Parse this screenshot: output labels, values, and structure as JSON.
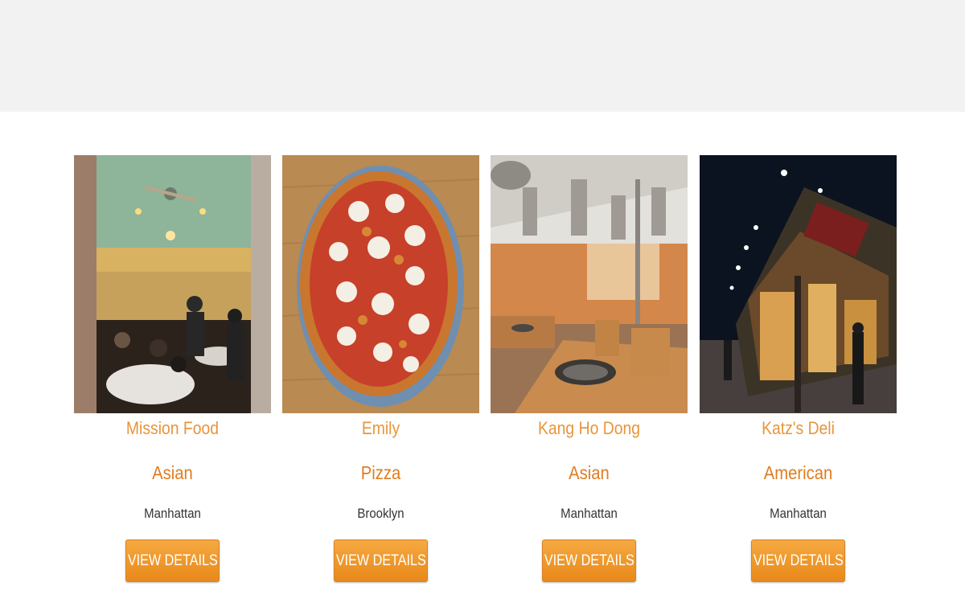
{
  "restaurants": [
    {
      "name": "Mission Food",
      "cuisine": "Asian",
      "borough": "Manhattan",
      "button_label": "VIEW DETAILS"
    },
    {
      "name": "Emily",
      "cuisine": "Pizza",
      "borough": "Brooklyn",
      "button_label": "VIEW DETAILS"
    },
    {
      "name": "Kang Ho Dong",
      "cuisine": "Asian",
      "borough": "Manhattan",
      "button_label": "VIEW DETAILS"
    },
    {
      "name": "Katz's Deli",
      "cuisine": "American",
      "borough": "Manhattan",
      "button_label": "VIEW DETAILS"
    }
  ],
  "colors": {
    "header_band": "#f2f2f2",
    "name_text": "#e8953a",
    "cuisine_text": "#e07c1f",
    "borough_text": "#333333",
    "button_bg": "#ee9a2e",
    "button_text": "#ffffff"
  }
}
